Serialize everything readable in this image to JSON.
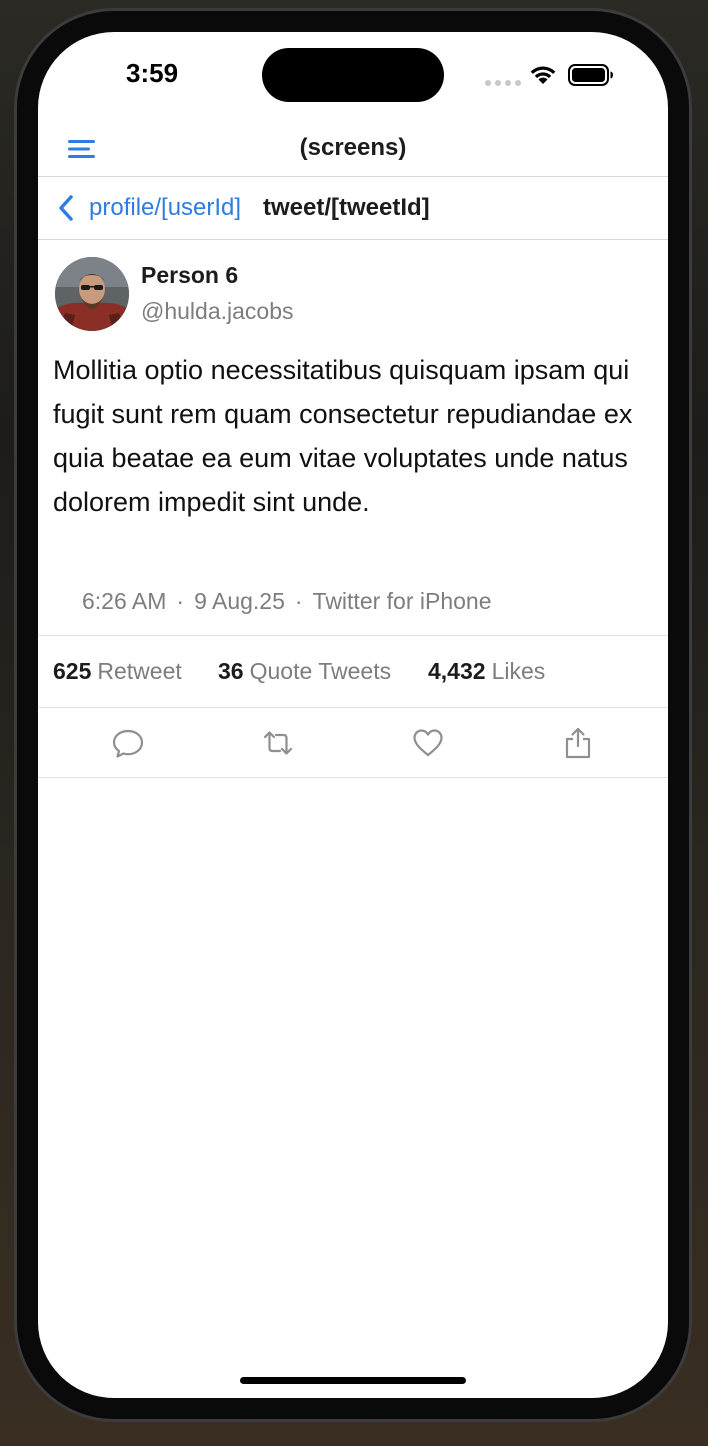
{
  "status_bar": {
    "time": "3:59"
  },
  "nav": {
    "title": "(screens)"
  },
  "sub_header": {
    "back_label": "profile/[userId]",
    "current_title": "tweet/[tweetId]"
  },
  "tweet": {
    "author_name": "Person 6",
    "author_handle": "@hulda.jacobs",
    "body": "Mollitia optio necessitatibus quisquam ipsam qui fugit sunt rem quam consectetur repudiandae ex quia beatae ea eum vitae voluptates unde natus dolorem impedit sint unde.",
    "time": "6:26 AM",
    "date": "9 Aug.25",
    "source": "Twitter for iPhone",
    "separator": "·"
  },
  "stats": {
    "retweets": {
      "count": "625",
      "label": "Retweet"
    },
    "quotes": {
      "count": "36",
      "label": "Quote Tweets"
    },
    "likes": {
      "count": "4,432",
      "label": "Likes"
    }
  },
  "actions": [
    "comment-icon",
    "retweet-icon",
    "heart-icon",
    "share-icon"
  ],
  "colors": {
    "accent": "#2f7de1",
    "secondary_text": "#7d7d7d",
    "divider": "#e2e2e2"
  }
}
